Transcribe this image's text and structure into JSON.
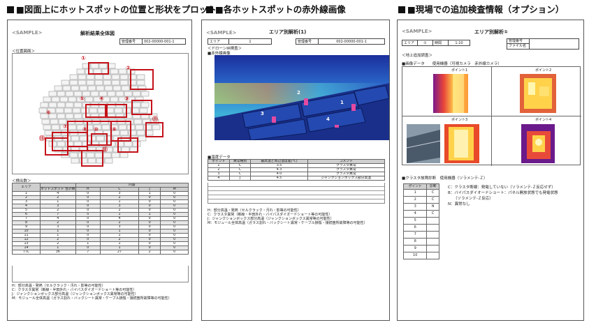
{
  "headings": [
    "■図面上にホットスポットの位置と形状をプロット",
    "■各ホットスポットの赤外線画像",
    "■現場での追加検査情報（オプション）"
  ],
  "p1": {
    "sample": "<SAMPLE>",
    "title": "解析結果全体図",
    "mgmt_label": "管理番号",
    "mgmt_value": "002-00000-001-1",
    "layout_label": "＜位置図面＞",
    "hotspot_labels": [
      "①",
      "②",
      "③",
      "④",
      "⑤",
      "⑥",
      "⑦",
      "⑧",
      "⑨",
      "⑩",
      "⑪",
      "⑫",
      "⑬"
    ],
    "results_label": "＜検出数＞",
    "table_head": [
      "エリア",
      "ホットスポット\n合計数",
      "H",
      "C",
      "J",
      "M"
    ],
    "table_group": "内容",
    "rows": [
      [
        "1",
        "4",
        "0",
        "3",
        "1",
        "0"
      ],
      [
        "2",
        "2",
        "0",
        "2",
        "0",
        "0"
      ],
      [
        "3",
        "1",
        "0",
        "1",
        "0",
        "0"
      ],
      [
        "4",
        "3",
        "0",
        "3",
        "0",
        "0"
      ],
      [
        "5",
        "2",
        "0",
        "2",
        "0",
        "0"
      ],
      [
        "6",
        "7",
        "5",
        "1",
        "1",
        "0"
      ],
      [
        "7",
        "4",
        "0",
        "4",
        "0",
        "0"
      ],
      [
        "8",
        "2",
        "0",
        "2",
        "0",
        "0"
      ],
      [
        "9",
        "3",
        "0",
        "3",
        "0",
        "0"
      ],
      [
        "10",
        "1",
        "0",
        "1",
        "0",
        "0"
      ],
      [
        "11",
        "1",
        "0",
        "1",
        "0",
        "0"
      ],
      [
        "12",
        "2",
        "0",
        "2",
        "0",
        "0"
      ],
      [
        "13",
        "2",
        "1",
        "1",
        "0",
        "0"
      ],
      [
        "14",
        "1",
        "0",
        "1",
        "0",
        "0"
      ],
      [
        "TTL",
        "36",
        "7",
        "27",
        "2",
        "0"
      ]
    ],
    "notes": [
      "H：部分高温・発熱（セルクラック・汚れ・影等の可能性）",
      "C：クラスタ異常（断線・半田外れ・バイパスダイオードショート等の可能性）",
      "J：ジャンクションボックス部分高温（ジャンクションボックス異常等の可能性）",
      "M：モジュール全体高温（ガラス割れ・バックシート異常・ケーブル損傷・接続箇所故障等の可能性）"
    ]
  },
  "p2": {
    "sample": "<SAMPLE>",
    "title": "エリア別解析(1)",
    "area_label": "エリア",
    "area_value": "1",
    "mgmt_label": "管理番号",
    "mgmt_value": "002-00000-001-1",
    "drone_label": "＜ドローンIR検査＞",
    "ir_label": "■赤外線画像",
    "ir_markers": [
      "2",
      "1",
      "3",
      "4"
    ],
    "temp_label": "■温度データ",
    "temp_head": [
      "ポイント",
      "異常種別",
      "最高温と周辺温度差(℃)",
      "コメント"
    ],
    "temp_rows": [
      [
        "1",
        "C",
        "3.5",
        "クラスタ異常"
      ],
      [
        "2",
        "C",
        "4.3",
        "クラスタ異常"
      ],
      [
        "3",
        "C",
        "4.0",
        "クラスタ異常"
      ],
      [
        "4",
        "J",
        "4.5",
        "ジャンクションボックス部分高温"
      ]
    ],
    "notes": [
      "H：部分高温・発熱（セルクラック・汚れ・影等の可能性）",
      "C：クラスタ異常（断線・半田外れ・バイパスダイオードショート等の可能性）",
      "J：ジャンクションボックス部分高温（ジャンクションボックス異常等の可能性）",
      "M：モジュール全体高温（ガラス割れ・バックシート異常・ケーブル損傷・接続箇所故障等の可能性）"
    ]
  },
  "p3": {
    "sample": "<SAMPLE>",
    "title": "エリア別解析①",
    "area_label": "エリア",
    "area_value": "①",
    "time_label": "時間",
    "time_value": "1:10",
    "mgmt_label": "管理番号",
    "file_label": "ファイル名",
    "ground_label": "＜地上追加調査＞",
    "img_label": "■画像データ　　使用機器（可視カメラ　赤外線カメラ）",
    "points": [
      "ポイント1",
      "ポイント2",
      "ポイント3",
      "ポイント4"
    ],
    "cluster_label": "■クラスタ故障診断　使用機器（ソラメンテ-Ｚ）",
    "diag_head": [
      "ポイント",
      "診断"
    ],
    "diag_rows": [
      [
        "1",
        "C"
      ],
      [
        "2",
        "C"
      ],
      [
        "3",
        "N"
      ],
      [
        "4",
        "C"
      ],
      [
        "5",
        ""
      ],
      [
        "6",
        ""
      ],
      [
        "7",
        ""
      ],
      [
        "8",
        ""
      ],
      [
        "9",
        ""
      ],
      [
        "10",
        ""
      ]
    ],
    "legend": [
      "C：クラスタ断線：発電していない（ソラメンテ-Ｚ反応せず）",
      "B：バイパスダイオードショート：パネル開放状態でも発電状態",
      "（ソラメンテ-Ｚ反応）",
      "N：異常なし"
    ]
  },
  "colors": {
    "hotspot": "#c4121a",
    "ir_bg": "#1d3ea8"
  }
}
